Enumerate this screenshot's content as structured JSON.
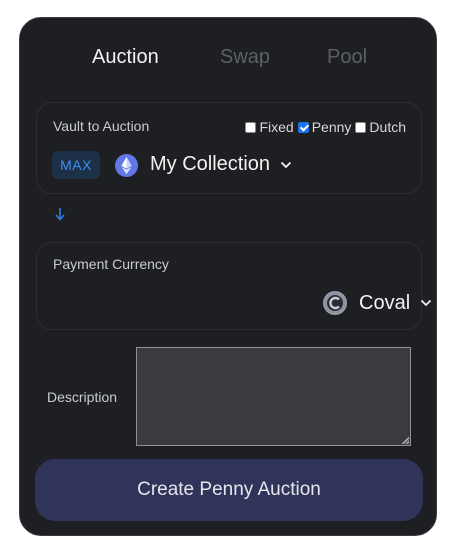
{
  "tabs": [
    {
      "label": "Auction",
      "active": true
    },
    {
      "label": "Swap",
      "active": false
    },
    {
      "label": "Pool",
      "active": false
    }
  ],
  "vault": {
    "label": "Vault to Auction",
    "max_label": "MAX",
    "selected": "My Collection",
    "icon": "ethereum-icon",
    "options": [
      {
        "label": "Fixed",
        "checked": false
      },
      {
        "label": "Penny",
        "checked": true
      },
      {
        "label": "Dutch",
        "checked": false
      }
    ]
  },
  "payment": {
    "label": "Payment Currency",
    "selected": "Coval",
    "icon": "coval-coin-icon"
  },
  "description": {
    "label": "Description",
    "value": ""
  },
  "create_button": "Create Penny Auction",
  "colors": {
    "card_bg": "#1e1f22",
    "accent_blue": "#1a73e8",
    "button_bg": "#31345a"
  }
}
